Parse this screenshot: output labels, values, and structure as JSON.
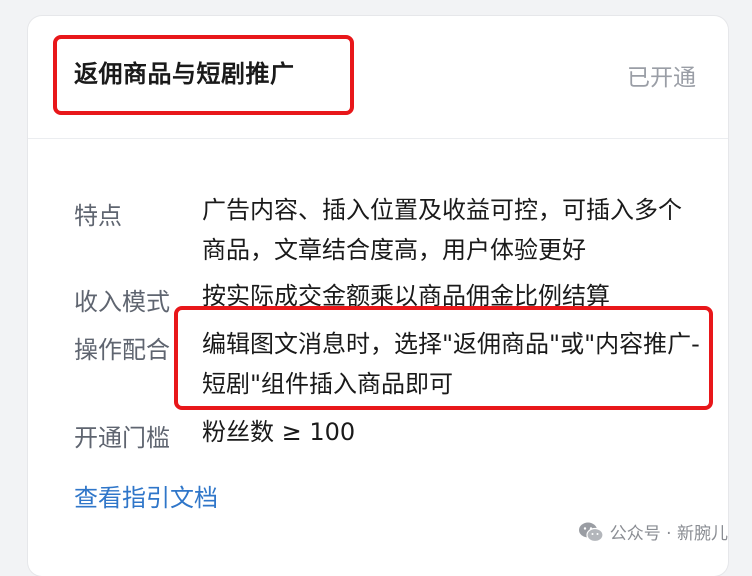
{
  "card": {
    "title": "返佣商品与短剧推广",
    "status": "已开通"
  },
  "rows": [
    {
      "label": "特点",
      "value": "广告内容、插入位置及收益可控，可插入多个商品，文章结合度高，用户体验更好"
    },
    {
      "label": "收入模式",
      "value": "按实际成交金额乘以商品佣金比例结算"
    },
    {
      "label": "操作配合",
      "value": "编辑图文消息时，选择\"返佣商品\"或\"内容推广-短剧\"组件插入商品即可"
    },
    {
      "label": "开通门槛",
      "value": "粉丝数 ≥ 100"
    }
  ],
  "guide_link": "查看指引文档",
  "watermark": {
    "text": "公众号 · 新腕儿",
    "icon": "wechat-icon"
  },
  "colors": {
    "highlight": "#e8171a",
    "link": "#2f76c9",
    "status": "#9a9ea6"
  }
}
